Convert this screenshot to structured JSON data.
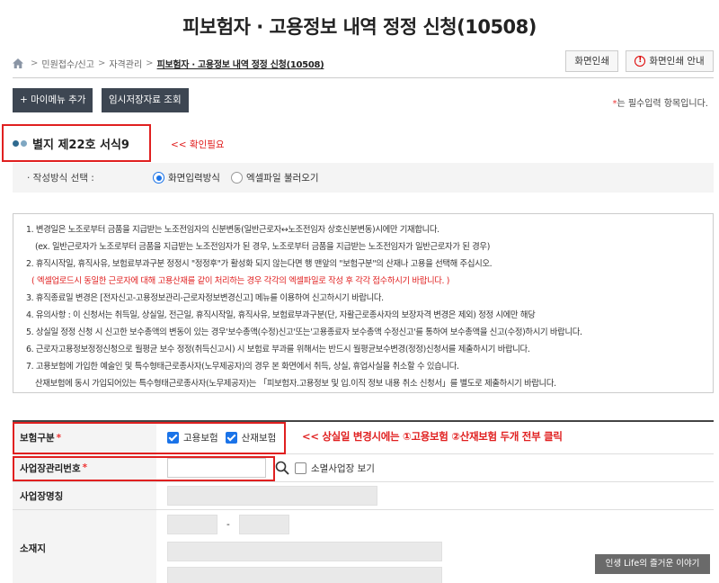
{
  "page": {
    "title": "피보험자 · 고용정보 내역 정정 신청(10508)"
  },
  "breadcrumb": {
    "items": [
      "민원접수/신고",
      "자격관리",
      "피보험자 · 고용정보 내역 정정 신청(10508)"
    ]
  },
  "top_buttons": {
    "print": "화면인쇄",
    "print_guide": "화면인쇄 안내"
  },
  "actions": {
    "add_menu": "+ 마이메뉴 추가",
    "temp_saved": "임시저장자료 조회"
  },
  "required_note": {
    "star": "*",
    "text": "는 필수입력 항목입니다."
  },
  "section": {
    "title": "별지 제22호 서식9",
    "annotation": "<< 확인필요"
  },
  "input_method": {
    "label": "· 작성방식 선택 :",
    "options": [
      {
        "label": "화면입력방식",
        "selected": true
      },
      {
        "label": "엑셀파일 불러오기",
        "selected": false
      }
    ]
  },
  "notice": {
    "lines": [
      "1. 변경일은 노조로부터 금품을 지급받는 노조전임자의 신분변동(일반근로자↔노조전임자 상호신분변동)시에만 기재합니다.",
      "(ex. 일반근로자가 노조로부터 금품을 지급받는 노조전임자가 된 경우, 노조로부터 금품을 지급받는 노조전임자가 일반근로자가 된 경우)",
      "2. 휴직시작일, 휴직사유, 보험료부과구분 정정시 \"정정후\"가 활성화 되지 않는다면 행 맨앞의 \"보험구분\"의 산재나 고용을 선택해 주십시오.",
      "( 엑셀업로드시 동일한 근로자에 대해 고용산재를 같이 처리하는 경우 각각의 엑셀파일로 작성 후 각각 접수하시기 바랍니다. )",
      "3. 휴직종료일 변경은 [전자신고-고용정보관리-근로자정보변경신고] 메뉴를 이용하여 신고하시기 바랍니다.",
      "4. 유의사항 : 이 신청서는 취득일, 상실일, 전근일, 휴직시작일, 휴직사유, 보험료부과구분(단, 자활근로종사자의 보장자격 변경은 제외) 정정 시에만 해당",
      "5. 상실일 정정 신청 시 신고한 보수총액의 변동이 있는 경우'보수총액(수정)신고'또는'고용종료자 보수총액 수정신고'를 통하여 보수총액을 신고(수정)하시기 바랍니다.",
      "6. 근로자고용정보정정신청으로 월평균 보수 정정(취득신고시) 시 보험료 부과를 위해서는 반드시 월평균보수변경(정정)신청서를 제출하시기 바랍니다.",
      "7. 고용보험에 가입한 예술인 및 특수형태근로종사자(노무제공자)의 경우 본 화면에서 취득, 상실, 휴업사실을 취소할 수 있습니다.",
      "산재보험에 동시 가입되어있는 특수형태근로종사자(노무제공자)는 「피보험자.고용정보 및 입.이직 정보 내용 취소 신청서」를 별도로 제출하시기 바랍니다."
    ]
  },
  "form": {
    "insurance_type": {
      "label": "보험구분",
      "required": "*",
      "options": [
        {
          "label": "고용보험",
          "checked": true
        },
        {
          "label": "산재보험",
          "checked": true
        }
      ]
    },
    "annotation": "<< 상실일 변경시에는 ①고용보험 ②산재보험  두개 전부 클릭",
    "business_no": {
      "label": "사업장관리번호",
      "required": "*",
      "closed_label": "소멸사업장 보기",
      "closed_checked": false
    },
    "business_name": {
      "label": "사업장명칭"
    },
    "address": {
      "label": "소재지",
      "dash": "-"
    }
  },
  "watermark": "인생 Life의 즐거운 이야기"
}
